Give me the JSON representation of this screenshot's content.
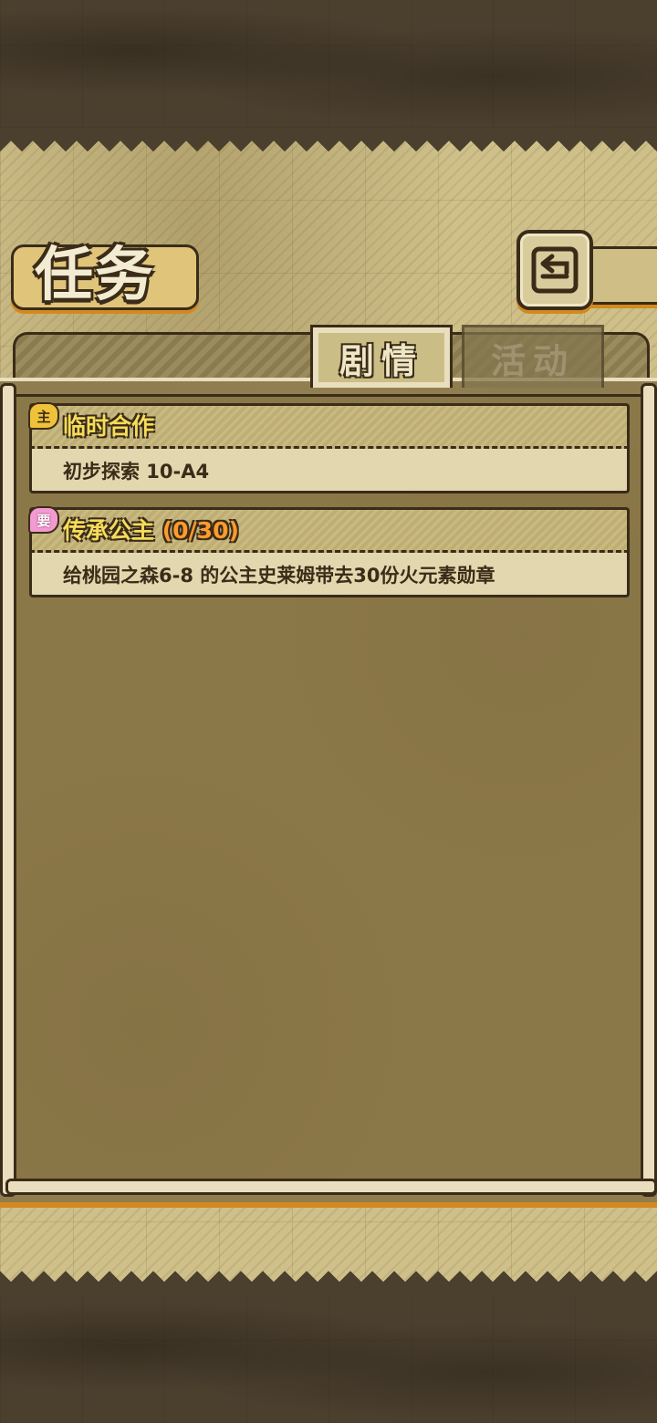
{
  "header": {
    "title": "任务",
    "back_icon": "return-arrow-icon"
  },
  "tabs": [
    {
      "label": "剧情",
      "active": true
    },
    {
      "label": "活动",
      "active": false
    }
  ],
  "quests": [
    {
      "badge": "主",
      "badge_icon": "main-quest-badge-icon",
      "title": "临时合作",
      "progress": "",
      "description": "初步探索 10-A4"
    },
    {
      "badge": "要",
      "badge_icon": "request-quest-badge-icon",
      "title": "传承公主",
      "progress": "(0/30)",
      "description": "给桃园之森6-8 的公主史莱姆带去30份火元素勋章"
    }
  ],
  "colors": {
    "accent_orange": "#d4891f",
    "title_yellow": "#f6dc5a",
    "progress_orange": "#ff9a2e",
    "outline": "#3a2c18"
  }
}
